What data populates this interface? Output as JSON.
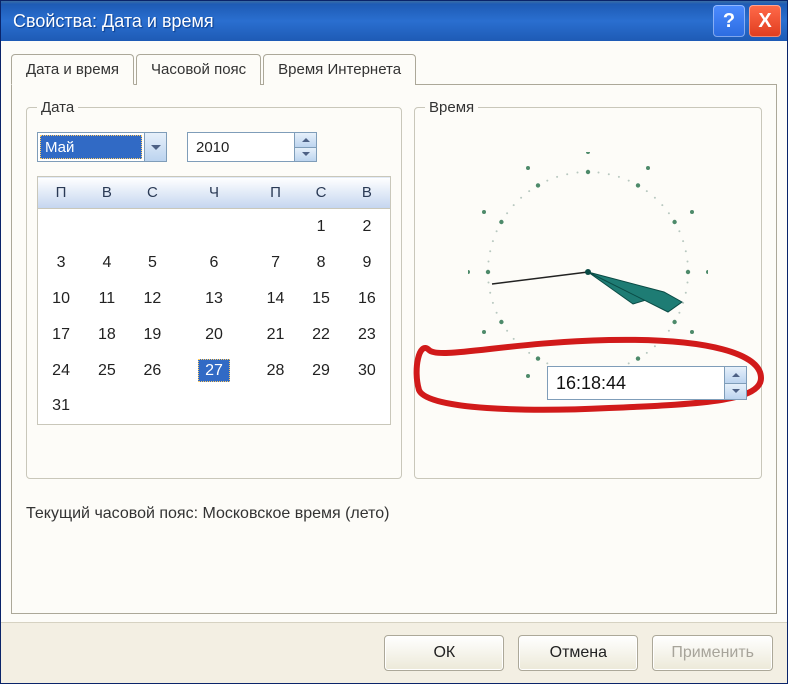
{
  "window": {
    "title": "Свойства: Дата и время"
  },
  "titlebar_buttons": {
    "help": "?",
    "close": "X"
  },
  "tabs": [
    {
      "label": "Дата и время",
      "active": true
    },
    {
      "label": "Часовой пояс",
      "active": false
    },
    {
      "label": "Время Интернета",
      "active": false
    }
  ],
  "groups": {
    "date": "Дата",
    "time": "Время"
  },
  "date": {
    "month": "Май",
    "year": "2010",
    "weekday_headers": [
      "П",
      "В",
      "С",
      "Ч",
      "П",
      "С",
      "В"
    ],
    "weeks": [
      [
        "",
        "",
        "",
        "",
        "",
        "1",
        "2"
      ],
      [
        "3",
        "4",
        "5",
        "6",
        "7",
        "8",
        "9"
      ],
      [
        "10",
        "11",
        "12",
        "13",
        "14",
        "15",
        "16"
      ],
      [
        "17",
        "18",
        "19",
        "20",
        "21",
        "22",
        "23"
      ],
      [
        "24",
        "25",
        "26",
        "27",
        "28",
        "29",
        "30"
      ],
      [
        "31",
        "",
        "",
        "",
        "",
        "",
        ""
      ]
    ],
    "selected_day": "27"
  },
  "time": {
    "value": "16:18:44"
  },
  "status": "Текущий часовой пояс: Московское время (лето)",
  "buttons": {
    "ok": "ОК",
    "cancel": "Отмена",
    "apply": "Применить"
  }
}
